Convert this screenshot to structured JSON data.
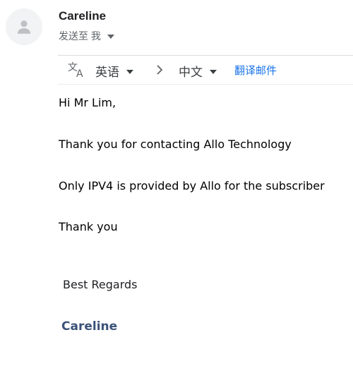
{
  "sender": {
    "name": "Careline",
    "avatar_icon": "person-icon"
  },
  "recipient": {
    "label": "发送至 我"
  },
  "translate_bar": {
    "icon": "translate-icon",
    "source_language": "英语",
    "target_language": "中文",
    "translate_link": "翻译邮件"
  },
  "message": {
    "lines": [
      "Hi Mr Lim,",
      "Thank you for contacting Allo Technology",
      "Only IPV4 is provided by Allo for the subscriber",
      "Thank you"
    ],
    "regards": "Best Regards",
    "signature": "Careline"
  },
  "colors": {
    "link": "#1a73e8",
    "signature": "#3b5278",
    "avatar_bg": "#f1f3f4"
  }
}
